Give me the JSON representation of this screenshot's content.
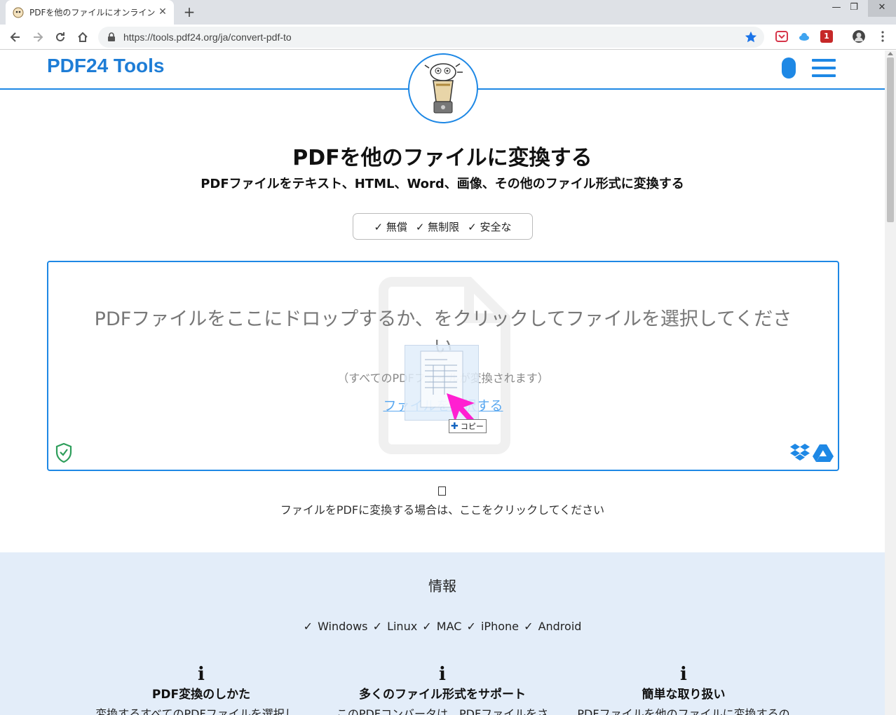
{
  "browser": {
    "tab_title": "PDFを他のファイルにオンラインで変換",
    "new_tab": "+",
    "tab_close": "✕",
    "url": "https://tools.pdf24.org/ja/convert-pdf-to",
    "window_minimize": "—",
    "window_restore": "❐",
    "window_close": "✕",
    "extension_badge": "1"
  },
  "header": {
    "brand": "PDF24 Tools"
  },
  "hero": {
    "title": "PDFを他のファイルに変換する",
    "subtitle": "PDFファイルをテキスト、HTML、Word、画像、その他のファイル形式に変換する",
    "features": [
      "✓ 無償",
      "✓ 無制限",
      "✓ 安全な"
    ]
  },
  "dropzone": {
    "main_text": "PDFファイルをここにドロップするか、をクリックしてファイルを選択してくださ",
    "main_text_wrap": "い",
    "note": "（すべてのPDFファイルが変換されます）",
    "link": "ファイルを選択する",
    "copy_tooltip": "コピー"
  },
  "convert_to_pdf": {
    "text": "ファイルをPDFに変換する場合は、ここをクリックしてください"
  },
  "info": {
    "title": "情報",
    "platforms": "✓ Windows   ✓ Linux   ✓ MAC   ✓ iPhone   ✓ Android",
    "columns": [
      {
        "title": "PDF変換のしかた",
        "text": "変換するすべてのPDFファイルを選択し、"
      },
      {
        "title": "多くのファイル形式をサポート",
        "text": "このPDFコンバータは、PDFファイルをさ"
      },
      {
        "title": "簡単な取り扱い",
        "text": "PDFファイルを他のファイルに変換するの"
      }
    ]
  },
  "colors": {
    "accent": "#1e88e5",
    "brand": "#1e7dd6",
    "info_background": "#e3edf9"
  }
}
